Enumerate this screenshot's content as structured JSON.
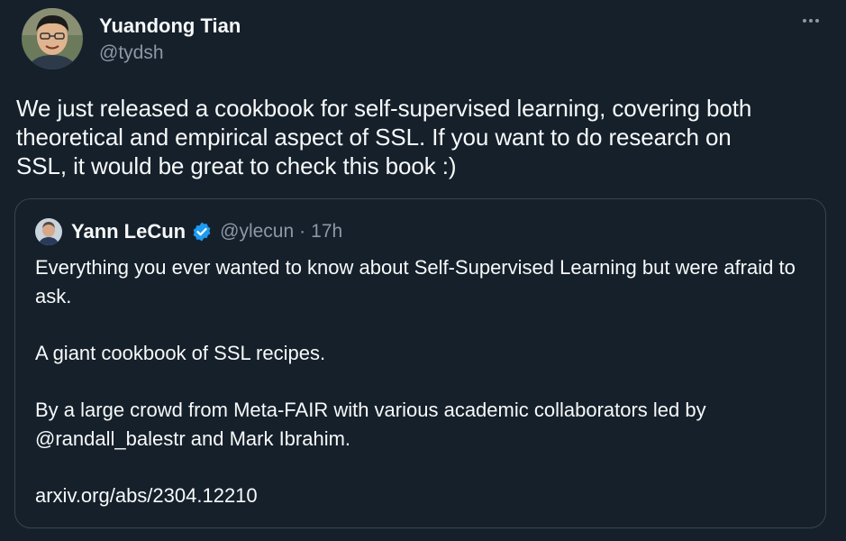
{
  "tweet": {
    "author": {
      "display_name": "Yuandong Tian",
      "handle": "@tydsh"
    },
    "more_icon": "more-horizontal-icon",
    "text": "We just released a cookbook for self-supervised learning, covering both\ntheoretical and empirical aspect of SSL. If you want to do research on\nSSL, it would be great to check this book :)"
  },
  "quote": {
    "author": {
      "display_name": "Yann LeCun",
      "handle": "@ylecun",
      "verified_icon": "verified-badge-icon"
    },
    "separator": "·",
    "time": "17h",
    "paragraphs": [
      "Everything you ever wanted to know about Self-Supervised Learning but were afraid to ask.",
      "A giant cookbook of SSL recipes.",
      "By a large crowd from Meta-FAIR with various academic collaborators led by @randall_balestr and Mark Ibrahim.",
      "arxiv.org/abs/2304.12210"
    ]
  },
  "colors": {
    "background": "#15202b",
    "text": "#f7f9f9",
    "secondary_text": "#8b98a5",
    "border": "#38444d",
    "verified": "#1d9bf0"
  }
}
